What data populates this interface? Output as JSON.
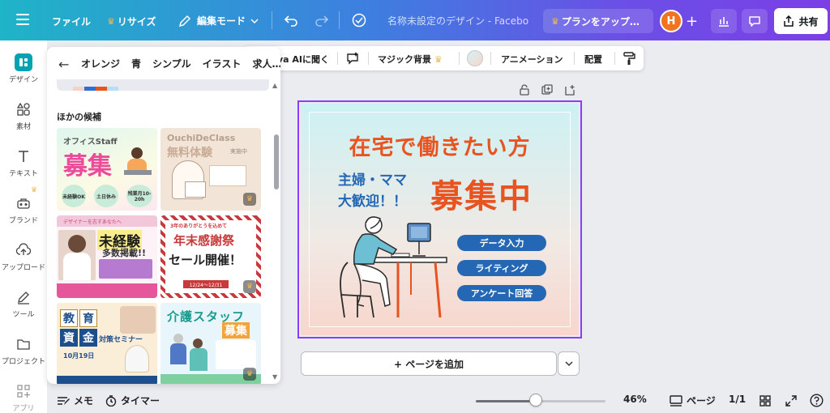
{
  "topbar": {
    "file": "ファイル",
    "resize": "リサイズ",
    "edit_mode": "編集モード",
    "doc_title": "名称未設定のデザイン - Facebo…",
    "upgrade": "プランをアップ…",
    "avatar_initial": "H",
    "share": "共有"
  },
  "sidebar": {
    "items": [
      {
        "label": "デザイン",
        "icon": "design-icon"
      },
      {
        "label": "素材",
        "icon": "elements-icon"
      },
      {
        "label": "テキスト",
        "icon": "text-icon"
      },
      {
        "label": "ブランド",
        "icon": "brand-icon"
      },
      {
        "label": "アップロード",
        "icon": "upload-icon"
      },
      {
        "label": "ツール",
        "icon": "draw-icon"
      },
      {
        "label": "プロジェクト",
        "icon": "folder-icon"
      },
      {
        "label": "アプリ",
        "icon": "apps-icon"
      }
    ]
  },
  "panel": {
    "chips": [
      "オレンジ",
      "青",
      "シンプル",
      "イラスト",
      "求人…"
    ],
    "section_title": "ほかの候補",
    "templates": [
      {
        "name": "office-staff",
        "line1": "オフィスStaff",
        "line2": "募集",
        "tags": [
          "未経験OK",
          "土日休み",
          "残業月10-20h"
        ]
      },
      {
        "name": "ouchi-de-class",
        "line1": "OuchiDeClass",
        "line2": "無料体験",
        "line3": "実施中"
      },
      {
        "name": "designer-recruit",
        "line1": "デザイナーを志すあなたへ",
        "line2": "未経験",
        "line3": "多数掲載!!"
      },
      {
        "name": "year-end-sale",
        "line1": "3年のありがとうを込めて",
        "line2": "年末感謝祭",
        "line3": "セール開催！",
        "date": "12/24〜12/31"
      },
      {
        "name": "education-seminar",
        "line1": "教育",
        "line2": "資金",
        "line3": "対策セミナー",
        "date": "10月19日"
      },
      {
        "name": "care-staff",
        "line1": "介護スタッフ",
        "line2": "募集"
      }
    ]
  },
  "context_toolbar": {
    "items": [
      "va AIに聞く",
      "マジック背景",
      "アニメーション",
      "配置"
    ]
  },
  "design": {
    "headline": "在宅で働きたい方",
    "sub1": "主婦・ママ",
    "sub2": "大歓迎！！",
    "big": "募集中",
    "pills": [
      "データ入力",
      "ライティング",
      "アンケート回答"
    ],
    "colors": {
      "orange": "#e8531f",
      "blue": "#2467b5"
    }
  },
  "canvas": {
    "add_page": "+ ページを追加"
  },
  "bottombar": {
    "notes": "メモ",
    "timer": "タイマー",
    "zoom": "46%",
    "zoom_fraction": 0.46,
    "pages": "ページ",
    "page_count": "1/1"
  }
}
